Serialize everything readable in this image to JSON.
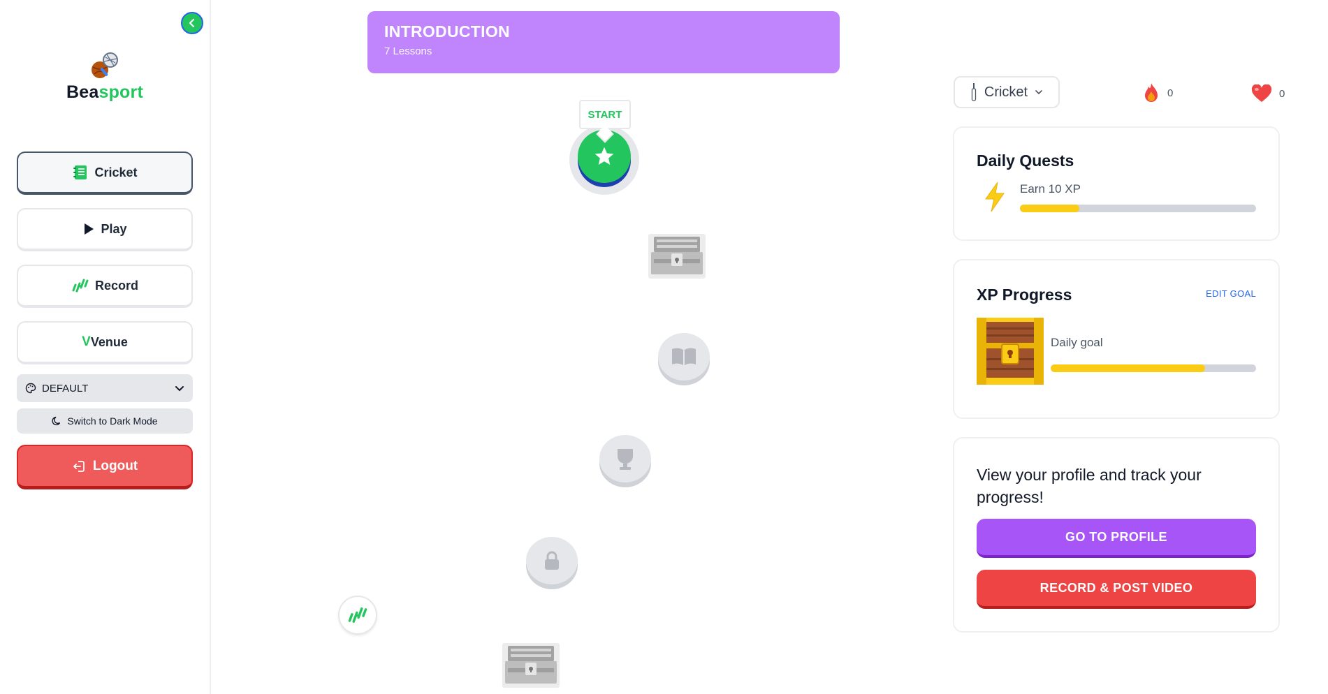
{
  "app": {
    "brand_part1": "Bea",
    "brand_part2": "sport",
    "brand_colors": {
      "primary": "#22c55e",
      "accent_purple": "#a855f7",
      "danger": "#ef4444"
    }
  },
  "sidebar": {
    "items": [
      {
        "label": "Cricket",
        "icon": "notebook-icon",
        "active": true
      },
      {
        "label": "Play",
        "icon": "play-icon"
      },
      {
        "label": "Record",
        "icon": "dumbbell-icon"
      },
      {
        "label": "Venue",
        "icon": "venue-v-icon",
        "prefix": "V"
      }
    ],
    "theme": {
      "label": "DEFAULT",
      "icon": "palette-icon"
    },
    "dark_mode_label": "Switch to Dark Mode",
    "logout_label": "Logout"
  },
  "unit": {
    "title": "INTRODUCTION",
    "subtitle": "7 Lessons"
  },
  "path": {
    "start_label": "START",
    "nodes": [
      {
        "type": "star",
        "state": "current"
      },
      {
        "type": "chest",
        "state": "locked"
      },
      {
        "type": "book",
        "state": "locked"
      },
      {
        "type": "trophy",
        "state": "locked"
      },
      {
        "type": "lock",
        "state": "locked"
      },
      {
        "type": "chest",
        "state": "locked"
      }
    ]
  },
  "topbar": {
    "course": "Cricket",
    "streak": "0",
    "hearts": "0"
  },
  "daily_quests": {
    "title": "Daily Quests",
    "quest": "Earn 10 XP",
    "progress": 0.25
  },
  "xp_progress": {
    "title": "XP Progress",
    "edit_label": "EDIT GOAL",
    "goal_label": "Daily goal",
    "progress": 0.75
  },
  "profile_card": {
    "text": "View your profile and track your progress!",
    "profile_button": "GO TO PROFILE",
    "record_button": "RECORD & POST VIDEO"
  }
}
